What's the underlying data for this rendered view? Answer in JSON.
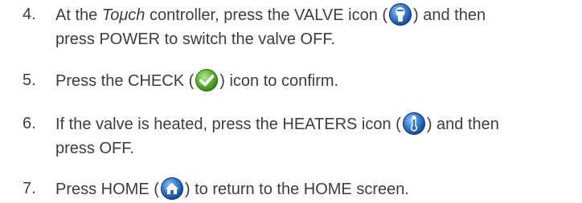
{
  "steps": [
    {
      "number": "4.",
      "parts": {
        "a": "At the ",
        "product": "Toμch",
        "b": " controller, press the VALVE icon (",
        "c": ") and then",
        "line2": "press POWER to switch the valve OFF."
      },
      "icon": "valve-icon"
    },
    {
      "number": "5.",
      "parts": {
        "a": "Press the CHECK (",
        "b": ") icon to confirm."
      },
      "icon": "check-icon"
    },
    {
      "number": "6.",
      "parts": {
        "a": "If the valve is heated, press the HEATERS icon (",
        "b": ") and then",
        "line2": "press OFF."
      },
      "icon": "heaters-icon"
    },
    {
      "number": "7.",
      "parts": {
        "a": "Press HOME (",
        "b": ") to return to the HOME screen."
      },
      "icon": "home-icon"
    }
  ],
  "colors": {
    "text": "#3d3d3d",
    "icon_blue_dark": "#0d3f8c",
    "icon_blue_light": "#5fa3e6",
    "check_green": "#5fb233"
  }
}
